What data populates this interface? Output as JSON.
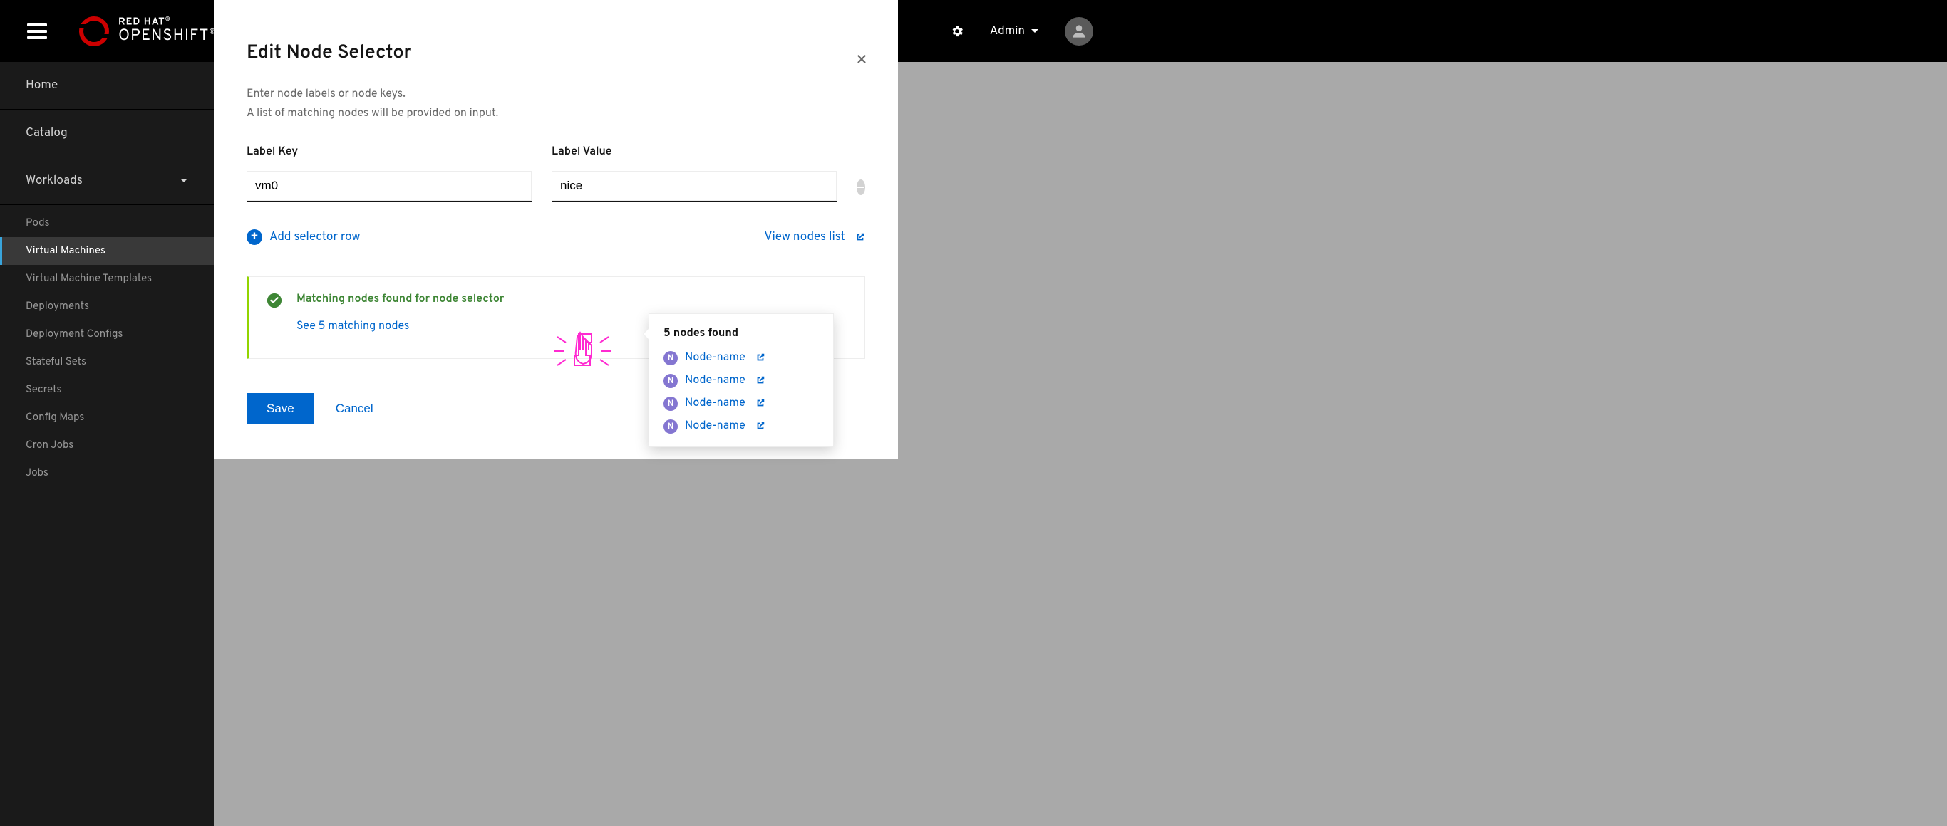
{
  "header": {
    "brand_line1": "RED HAT",
    "brand_line2": "OPENSHIFT",
    "user_label": "Admin"
  },
  "sidebar": {
    "items": [
      {
        "label": "Home"
      },
      {
        "label": "Catalog"
      },
      {
        "label": "Workloads",
        "expanded": true
      }
    ],
    "workloads": [
      {
        "label": "Pods"
      },
      {
        "label": "Virtual Machines",
        "active": true
      },
      {
        "label": "Virtual Machine Templates"
      },
      {
        "label": "Deployments"
      },
      {
        "label": "Deployment Configs"
      },
      {
        "label": "Stateful Sets"
      },
      {
        "label": "Secrets"
      },
      {
        "label": "Config Maps"
      },
      {
        "label": "Cron Jobs"
      },
      {
        "label": "Jobs"
      }
    ]
  },
  "modal": {
    "title": "Edit Node Selector",
    "desc_line1": "Enter node labels or node keys.",
    "desc_line2": "A list of matching nodes will be provided on input.",
    "label_key_label": "Label Key",
    "label_value_label": "Label Value",
    "label_key_value": "vm0",
    "label_value_value": "nice",
    "add_row": "Add selector row",
    "view_nodes": "View nodes list",
    "alert_title": "Matching nodes found for node selector",
    "alert_link": "See 5 matching nodes",
    "save": "Save",
    "cancel": "Cancel"
  },
  "popover": {
    "title": "5 nodes found",
    "nodes": [
      {
        "badge": "N",
        "name": "Node-name"
      },
      {
        "badge": "N",
        "name": "Node-name"
      },
      {
        "badge": "N",
        "name": "Node-name"
      },
      {
        "badge": "N",
        "name": "Node-name"
      }
    ]
  }
}
